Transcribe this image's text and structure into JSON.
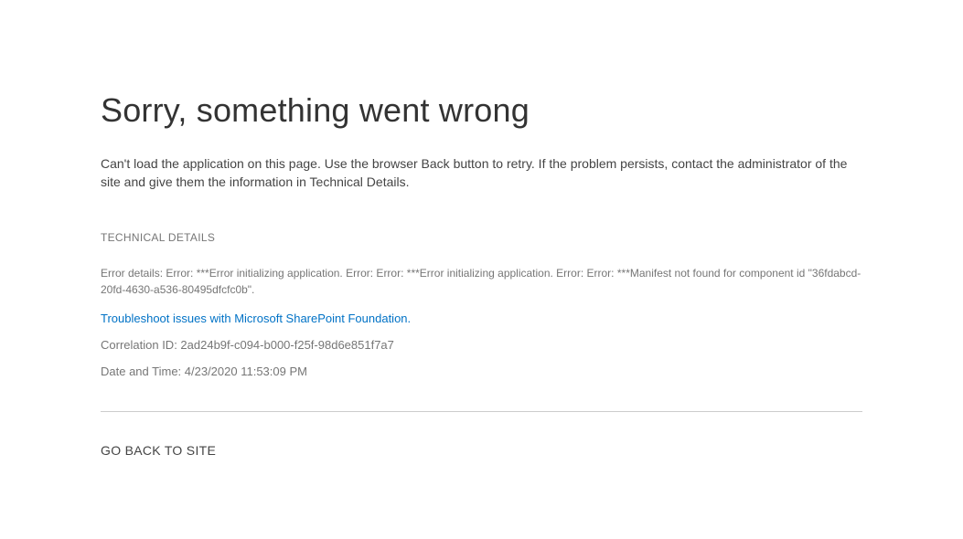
{
  "title": "Sorry, something went wrong",
  "message": "Can't load the application on this page. Use the browser Back button to retry. If the problem persists, contact the administrator of the site and give them the information in Technical Details.",
  "technical": {
    "heading": "TECHNICAL DETAILS",
    "error_details": "Error details: Error: ***Error initializing application. Error: Error: ***Error initializing application. Error: Error: ***Manifest not found for component id \"36fdabcd-20fd-4630-a536-80495dfcfc0b\".",
    "troubleshoot_link": "Troubleshoot issues with Microsoft SharePoint Foundation.",
    "correlation": "Correlation ID: 2ad24b9f-c094-b000-f25f-98d6e851f7a7",
    "datetime": "Date and Time: 4/23/2020 11:53:09 PM"
  },
  "go_back_label": "GO BACK TO SITE"
}
